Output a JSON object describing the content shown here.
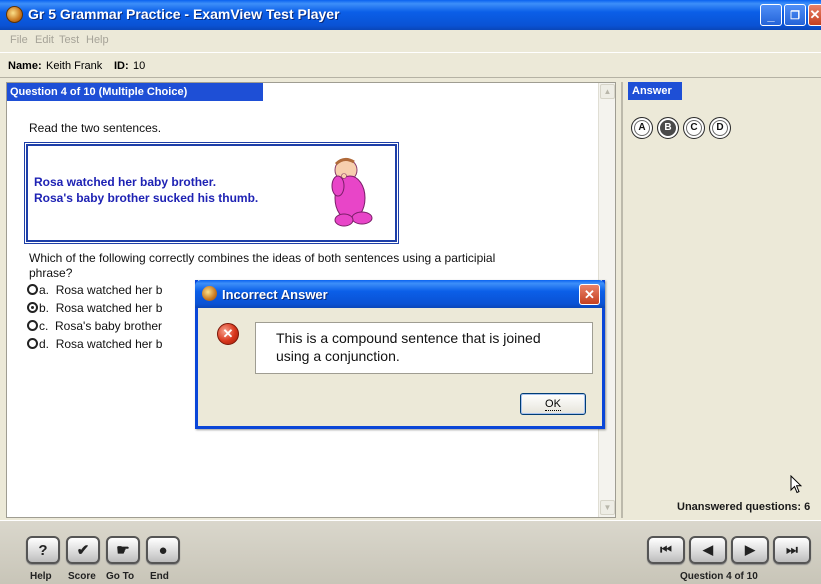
{
  "window": {
    "title": "Gr 5 Grammar Practice - ExamView Test Player",
    "minimize_glyph": "_",
    "maximize_glyph": "❐",
    "close_glyph": "✕"
  },
  "menu": [
    "File",
    "Edit",
    "Test",
    "Help"
  ],
  "student": {
    "name_label": "Name:",
    "name": "Keith Frank",
    "id_label": "ID:",
    "id": "10"
  },
  "question": {
    "header": "Question 4 of 10 (Multiple Choice)",
    "prompt": "Read the two sentences.",
    "passage": [
      "Rosa watched her baby brother.",
      "Rosa's baby brother sucked his thumb."
    ],
    "stem_line1": "Which of the following correctly combines the ideas of both sentences using a participial",
    "stem_line2": "phrase?",
    "options": [
      {
        "letter": "a.",
        "text": "Rosa watched her b",
        "selected": false
      },
      {
        "letter": "b.",
        "text": "Rosa watched her b",
        "selected": true
      },
      {
        "letter": "c.",
        "text": "Rosa's baby brother",
        "selected": false
      },
      {
        "letter": "d.",
        "text": "Rosa watched her b",
        "selected": false
      }
    ]
  },
  "answer_panel": {
    "header": "Answer",
    "choices": [
      "A",
      "B",
      "C",
      "D"
    ],
    "selected": "B",
    "unanswered": "Unanswered questions: 6"
  },
  "toolbar": {
    "help_label": "Help",
    "score_label": "Score",
    "goto_label": "Go To",
    "end_label": "End",
    "help_glyph": "?",
    "score_glyph": "✔",
    "goto_glyph": "☛",
    "end_glyph": "●",
    "first_glyph": "⏮",
    "prev_glyph": "◀",
    "next_glyph": "▶",
    "last_glyph": "⏭",
    "question_count": "Question 4 of 10"
  },
  "dialog": {
    "title": "Incorrect Answer",
    "close_glyph": "✕",
    "error_glyph": "✕",
    "message_line1": "This is a compound sentence that is joined",
    "message_line2": "using a conjunction.",
    "ok_label": "OK"
  },
  "colors": {
    "titlebar": "#0a52d4",
    "header_blue": "#1e4fd6",
    "passage_text": "#1e22b4",
    "passage_border": "#1e3fa8",
    "baby_pink": "#e845c8"
  },
  "icons": {
    "app": "examview-app-icon",
    "baby": "baby-clipart",
    "error": "error-icon",
    "cursor": "mouse-pointer-icon"
  }
}
